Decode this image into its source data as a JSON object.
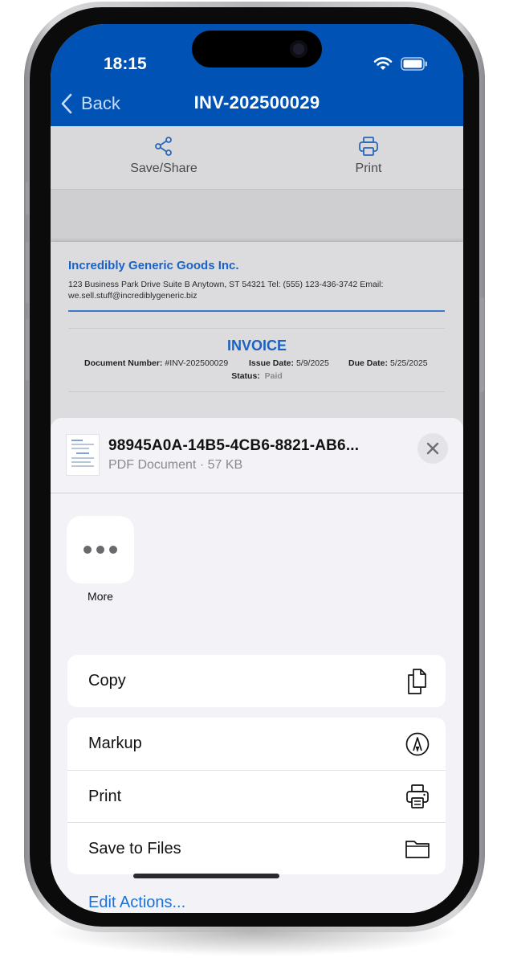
{
  "status_bar": {
    "time": "18:15"
  },
  "header": {
    "back_label": "Back",
    "title": "INV-202500029",
    "background_color": "#0052b4"
  },
  "toolbar": {
    "items": [
      {
        "label": "Save/Share",
        "icon": "share-icon"
      },
      {
        "label": "Print",
        "icon": "printer-icon"
      }
    ]
  },
  "invoice": {
    "company_name": "Incredibly Generic Goods Inc.",
    "company_address": "123 Business Park Drive Suite B Anytown, ST 54321 Tel: (555) 123-436-3742 Email: we.sell.stuff@incrediblygeneric.biz",
    "heading": "INVOICE",
    "document_number_label": "Document Number:",
    "document_number": "#INV-202500029",
    "issue_date_label": "Issue Date:",
    "issue_date": "5/9/2025",
    "due_date_label": "Due Date:",
    "due_date": "5/25/2025",
    "status_label": "Status:",
    "status": "Paid",
    "accent_color": "#1a62c4"
  },
  "share_sheet": {
    "file_name": "98945A0A-14B5-4CB6-8821-AB6...",
    "file_meta": "PDF Document · 57 KB",
    "apps": [
      {
        "label": "More",
        "icon": "more-icon"
      }
    ],
    "action_groups": [
      [
        {
          "label": "Copy",
          "icon": "copy-icon"
        }
      ],
      [
        {
          "label": "Markup",
          "icon": "markup-icon"
        },
        {
          "label": "Print",
          "icon": "printer-icon"
        },
        {
          "label": "Save to Files",
          "icon": "folder-icon"
        }
      ]
    ],
    "edit_actions_label": "Edit Actions...",
    "link_color": "#1a72d9"
  }
}
